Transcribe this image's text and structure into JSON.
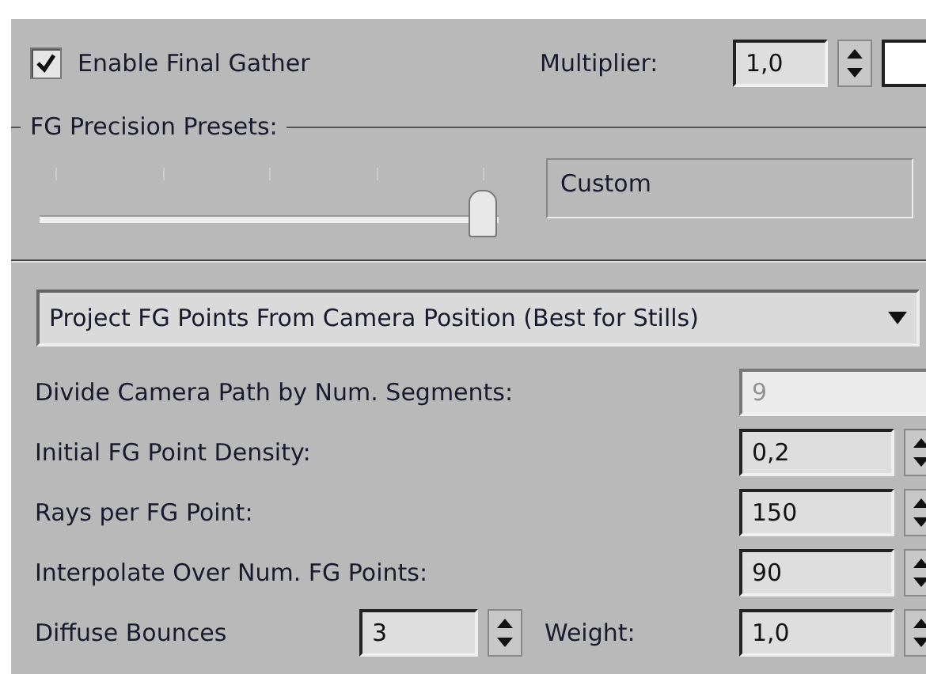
{
  "enable_final_gather": {
    "label": "Enable Final Gather",
    "checked": true
  },
  "multiplier": {
    "label": "Multiplier:",
    "value": "1,0"
  },
  "presets": {
    "title": "FG Precision Presets:",
    "level": 1.0,
    "value": "Custom"
  },
  "projection_mode": {
    "value": "Project FG Points From Camera Position (Best for Stills)"
  },
  "settings": [
    {
      "kind": "dropdown",
      "label": "Divide Camera Path by Num. Segments:",
      "value": "9",
      "disabled": true
    },
    {
      "kind": "spinner",
      "label": "Initial FG Point Density:",
      "value": "0,2",
      "disabled": false
    },
    {
      "kind": "spinner",
      "label": "Rays per FG Point:",
      "value": "150",
      "disabled": false
    },
    {
      "kind": "spinner",
      "label": "Interpolate Over Num. FG Points:",
      "value": "90",
      "disabled": false
    }
  ],
  "bounces": {
    "label": "Diffuse Bounces",
    "value": "3"
  },
  "weight": {
    "label": "Weight:",
    "value": "1,0"
  }
}
